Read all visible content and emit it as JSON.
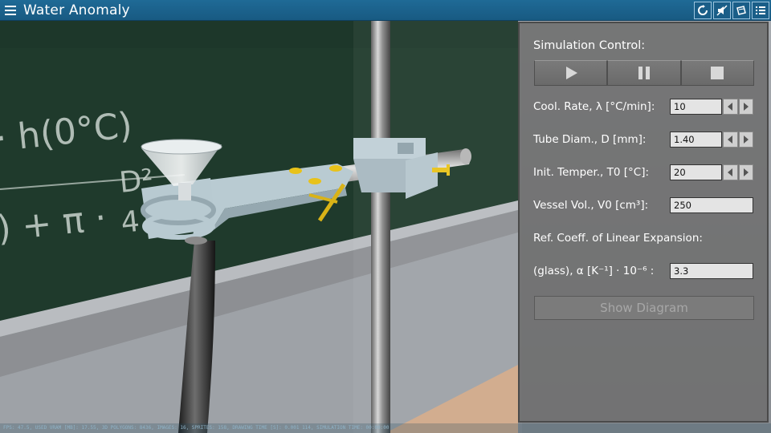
{
  "app": {
    "title": "Water Anomaly"
  },
  "toolbar": {
    "icons": [
      "menu-icon",
      "reset-icon",
      "mute-icon",
      "view-icon",
      "settings-icon"
    ]
  },
  "panel": {
    "heading": "Simulation Control:",
    "buttons": [
      "play-icon",
      "pause-icon",
      "stop-icon"
    ],
    "fields": [
      {
        "label": "Cool. Rate, λ [°C/min]:",
        "value": "10"
      },
      {
        "label": "Tube Diam., D [mm]:",
        "value": "1.40"
      },
      {
        "label": "Init. Temper., T0 [°C]:",
        "value": "20"
      },
      {
        "label": "Vessel Vol., V0 [cm³]:",
        "value": "250"
      }
    ],
    "expansion_label": "Ref. Coeff. of Linear Expansion:",
    "glass": {
      "label": "(glass), α [K⁻¹] · 10⁻⁶ :",
      "value": "3.3"
    },
    "show_diagram": "Show Diagram"
  },
  "scene": {
    "board_text_1": "· h(0°C)",
    "board_text_2": ") + π ·",
    "board_text_3": "D²",
    "board_text_4": "4"
  },
  "status": "FPS: 47.5, USED VRAM [MB]: 17.55, 3D POLYGONS: 8436, IMAGES: 16, SPRITES: 158, DRAWING TIME [S]: 0.001 114, SIMULATION TIME: 00:00:00"
}
